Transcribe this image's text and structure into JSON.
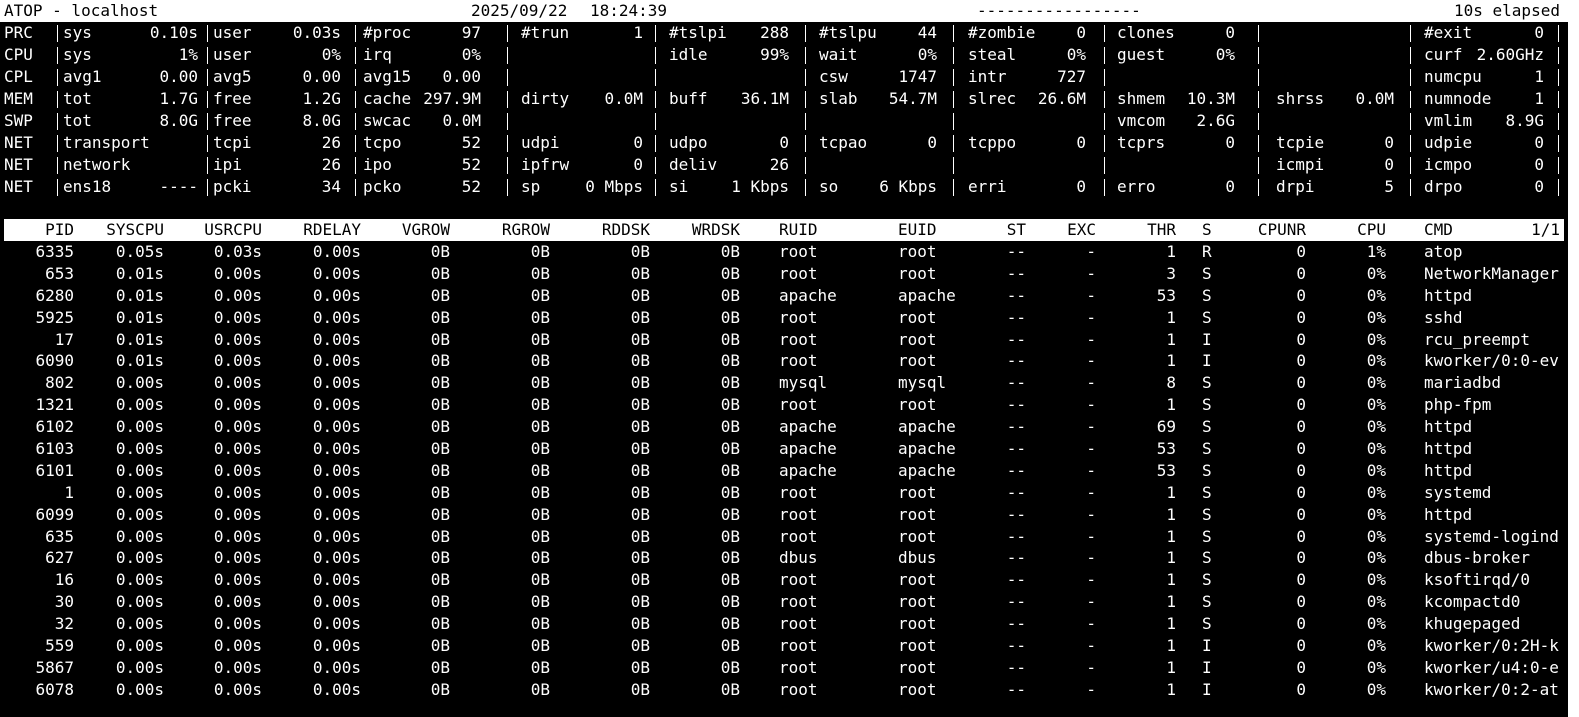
{
  "header": {
    "app": "ATOP - localhost",
    "date": "2025/09/22",
    "time": "18:24:39",
    "dashes": "-----------------",
    "elapsed": "10s elapsed"
  },
  "stats": [
    {
      "label": "PRC",
      "cells": [
        {
          "k": "sys",
          "v": "0.10s"
        },
        {
          "k": "user",
          "v": "0.03s"
        },
        {
          "k": "#proc",
          "v": "97"
        },
        {
          "k": "#trun",
          "v": "1"
        },
        {
          "k": "#tslpi",
          "v": "288"
        },
        {
          "k": "#tslpu",
          "v": "44"
        },
        {
          "k": "#zombie",
          "v": "0"
        },
        {
          "k": "clones",
          "v": "0"
        },
        {
          "k": "",
          "v": ""
        },
        {
          "k": "#exit",
          "v": "0"
        }
      ]
    },
    {
      "label": "CPU",
      "cells": [
        {
          "k": "sys",
          "v": "1%"
        },
        {
          "k": "user",
          "v": "0%"
        },
        {
          "k": "irq",
          "v": "0%"
        },
        {
          "k": "",
          "v": ""
        },
        {
          "k": "idle",
          "v": "99%"
        },
        {
          "k": "wait",
          "v": "0%"
        },
        {
          "k": "steal",
          "v": "0%"
        },
        {
          "k": "guest",
          "v": "0%"
        },
        {
          "k": "",
          "v": ""
        },
        {
          "k": "curf",
          "v": "2.60GHz"
        }
      ]
    },
    {
      "label": "CPL",
      "cells": [
        {
          "k": "avg1",
          "v": "0.00"
        },
        {
          "k": "avg5",
          "v": "0.00"
        },
        {
          "k": "avg15",
          "v": "0.00"
        },
        {
          "k": "",
          "v": ""
        },
        {
          "k": "",
          "v": ""
        },
        {
          "k": "csw",
          "v": "1747"
        },
        {
          "k": "intr",
          "v": "727"
        },
        {
          "k": "",
          "v": ""
        },
        {
          "k": "",
          "v": ""
        },
        {
          "k": "numcpu",
          "v": "1"
        }
      ]
    },
    {
      "label": "MEM",
      "cells": [
        {
          "k": "tot",
          "v": "1.7G"
        },
        {
          "k": "free",
          "v": "1.2G"
        },
        {
          "k": "cache",
          "v": "297.9M"
        },
        {
          "k": "dirty",
          "v": "0.0M"
        },
        {
          "k": "buff",
          "v": "36.1M"
        },
        {
          "k": "slab",
          "v": "54.7M"
        },
        {
          "k": "slrec",
          "v": "26.6M"
        },
        {
          "k": "shmem",
          "v": "10.3M"
        },
        {
          "k": "shrss",
          "v": "0.0M"
        },
        {
          "k": "numnode",
          "v": "1"
        }
      ]
    },
    {
      "label": "SWP",
      "cells": [
        {
          "k": "tot",
          "v": "8.0G"
        },
        {
          "k": "free",
          "v": "8.0G"
        },
        {
          "k": "swcac",
          "v": "0.0M"
        },
        {
          "k": "",
          "v": ""
        },
        {
          "k": "",
          "v": ""
        },
        {
          "k": "",
          "v": ""
        },
        {
          "k": "",
          "v": ""
        },
        {
          "k": "vmcom",
          "v": "2.6G"
        },
        {
          "k": "",
          "v": ""
        },
        {
          "k": "vmlim",
          "v": "8.9G"
        }
      ]
    },
    {
      "label": "NET",
      "cells": [
        {
          "k": "transport",
          "v": ""
        },
        {
          "k": "tcpi",
          "v": "26"
        },
        {
          "k": "tcpo",
          "v": "52"
        },
        {
          "k": "udpi",
          "v": "0"
        },
        {
          "k": "udpo",
          "v": "0"
        },
        {
          "k": "tcpao",
          "v": "0"
        },
        {
          "k": "tcppo",
          "v": "0"
        },
        {
          "k": "tcprs",
          "v": "0"
        },
        {
          "k": "tcpie",
          "v": "0"
        },
        {
          "k": "udpie",
          "v": "0"
        }
      ]
    },
    {
      "label": "NET",
      "cells": [
        {
          "k": "network",
          "v": ""
        },
        {
          "k": "ipi",
          "v": "26"
        },
        {
          "k": "ipo",
          "v": "52"
        },
        {
          "k": "ipfrw",
          "v": "0"
        },
        {
          "k": "deliv",
          "v": "26"
        },
        {
          "k": "",
          "v": ""
        },
        {
          "k": "",
          "v": ""
        },
        {
          "k": "",
          "v": ""
        },
        {
          "k": "icmpi",
          "v": "0"
        },
        {
          "k": "icmpo",
          "v": "0"
        }
      ]
    },
    {
      "label": "NET",
      "cells": [
        {
          "k": "ens18",
          "v": "----"
        },
        {
          "k": "pcki",
          "v": "34"
        },
        {
          "k": "pcko",
          "v": "52"
        },
        {
          "k": "sp",
          "v": "0 Mbps"
        },
        {
          "k": "si",
          "v": "1 Kbps"
        },
        {
          "k": "so",
          "v": "6 Kbps"
        },
        {
          "k": "erri",
          "v": "0"
        },
        {
          "k": "erro",
          "v": "0"
        },
        {
          "k": "drpi",
          "v": "5"
        },
        {
          "k": "drpo",
          "v": "0"
        }
      ]
    }
  ],
  "process_header": {
    "pid": "PID",
    "syscpu": "SYSCPU",
    "usrcpu": "USRCPU",
    "rdelay": "RDELAY",
    "vgrow": "VGROW",
    "rgrow": "RGROW",
    "rddsk": "RDDSK",
    "wrdsk": "WRDSK",
    "ruid": "RUID",
    "euid": "EUID",
    "st": "ST",
    "exc": "EXC",
    "thr": "THR",
    "s": "S",
    "cpunr": "CPUNR",
    "cpu": "CPU",
    "cmd": "CMD",
    "page": "1/1"
  },
  "processes": [
    {
      "pid": "6335",
      "syscpu": "0.05s",
      "usrcpu": "0.03s",
      "rdelay": "0.00s",
      "vgrow": "0B",
      "rgrow": "0B",
      "rddsk": "0B",
      "wrdsk": "0B",
      "ruid": "root",
      "euid": "root",
      "st": "--",
      "exc": "-",
      "thr": "1",
      "s": "R",
      "cpunr": "0",
      "cpu": "1%",
      "cmd": "atop"
    },
    {
      "pid": "653",
      "syscpu": "0.01s",
      "usrcpu": "0.00s",
      "rdelay": "0.00s",
      "vgrow": "0B",
      "rgrow": "0B",
      "rddsk": "0B",
      "wrdsk": "0B",
      "ruid": "root",
      "euid": "root",
      "st": "--",
      "exc": "-",
      "thr": "3",
      "s": "S",
      "cpunr": "0",
      "cpu": "0%",
      "cmd": "NetworkManager"
    },
    {
      "pid": "6280",
      "syscpu": "0.01s",
      "usrcpu": "0.00s",
      "rdelay": "0.00s",
      "vgrow": "0B",
      "rgrow": "0B",
      "rddsk": "0B",
      "wrdsk": "0B",
      "ruid": "apache",
      "euid": "apache",
      "st": "--",
      "exc": "-",
      "thr": "53",
      "s": "S",
      "cpunr": "0",
      "cpu": "0%",
      "cmd": "httpd"
    },
    {
      "pid": "5925",
      "syscpu": "0.01s",
      "usrcpu": "0.00s",
      "rdelay": "0.00s",
      "vgrow": "0B",
      "rgrow": "0B",
      "rddsk": "0B",
      "wrdsk": "0B",
      "ruid": "root",
      "euid": "root",
      "st": "--",
      "exc": "-",
      "thr": "1",
      "s": "S",
      "cpunr": "0",
      "cpu": "0%",
      "cmd": "sshd"
    },
    {
      "pid": "17",
      "syscpu": "0.01s",
      "usrcpu": "0.00s",
      "rdelay": "0.00s",
      "vgrow": "0B",
      "rgrow": "0B",
      "rddsk": "0B",
      "wrdsk": "0B",
      "ruid": "root",
      "euid": "root",
      "st": "--",
      "exc": "-",
      "thr": "1",
      "s": "I",
      "cpunr": "0",
      "cpu": "0%",
      "cmd": "rcu_preempt"
    },
    {
      "pid": "6090",
      "syscpu": "0.01s",
      "usrcpu": "0.00s",
      "rdelay": "0.00s",
      "vgrow": "0B",
      "rgrow": "0B",
      "rddsk": "0B",
      "wrdsk": "0B",
      "ruid": "root",
      "euid": "root",
      "st": "--",
      "exc": "-",
      "thr": "1",
      "s": "I",
      "cpunr": "0",
      "cpu": "0%",
      "cmd": "kworker/0:0-ev"
    },
    {
      "pid": "802",
      "syscpu": "0.00s",
      "usrcpu": "0.00s",
      "rdelay": "0.00s",
      "vgrow": "0B",
      "rgrow": "0B",
      "rddsk": "0B",
      "wrdsk": "0B",
      "ruid": "mysql",
      "euid": "mysql",
      "st": "--",
      "exc": "-",
      "thr": "8",
      "s": "S",
      "cpunr": "0",
      "cpu": "0%",
      "cmd": "mariadbd"
    },
    {
      "pid": "1321",
      "syscpu": "0.00s",
      "usrcpu": "0.00s",
      "rdelay": "0.00s",
      "vgrow": "0B",
      "rgrow": "0B",
      "rddsk": "0B",
      "wrdsk": "0B",
      "ruid": "root",
      "euid": "root",
      "st": "--",
      "exc": "-",
      "thr": "1",
      "s": "S",
      "cpunr": "0",
      "cpu": "0%",
      "cmd": "php-fpm"
    },
    {
      "pid": "6102",
      "syscpu": "0.00s",
      "usrcpu": "0.00s",
      "rdelay": "0.00s",
      "vgrow": "0B",
      "rgrow": "0B",
      "rddsk": "0B",
      "wrdsk": "0B",
      "ruid": "apache",
      "euid": "apache",
      "st": "--",
      "exc": "-",
      "thr": "69",
      "s": "S",
      "cpunr": "0",
      "cpu": "0%",
      "cmd": "httpd"
    },
    {
      "pid": "6103",
      "syscpu": "0.00s",
      "usrcpu": "0.00s",
      "rdelay": "0.00s",
      "vgrow": "0B",
      "rgrow": "0B",
      "rddsk": "0B",
      "wrdsk": "0B",
      "ruid": "apache",
      "euid": "apache",
      "st": "--",
      "exc": "-",
      "thr": "53",
      "s": "S",
      "cpunr": "0",
      "cpu": "0%",
      "cmd": "httpd"
    },
    {
      "pid": "6101",
      "syscpu": "0.00s",
      "usrcpu": "0.00s",
      "rdelay": "0.00s",
      "vgrow": "0B",
      "rgrow": "0B",
      "rddsk": "0B",
      "wrdsk": "0B",
      "ruid": "apache",
      "euid": "apache",
      "st": "--",
      "exc": "-",
      "thr": "53",
      "s": "S",
      "cpunr": "0",
      "cpu": "0%",
      "cmd": "httpd"
    },
    {
      "pid": "1",
      "syscpu": "0.00s",
      "usrcpu": "0.00s",
      "rdelay": "0.00s",
      "vgrow": "0B",
      "rgrow": "0B",
      "rddsk": "0B",
      "wrdsk": "0B",
      "ruid": "root",
      "euid": "root",
      "st": "--",
      "exc": "-",
      "thr": "1",
      "s": "S",
      "cpunr": "0",
      "cpu": "0%",
      "cmd": "systemd"
    },
    {
      "pid": "6099",
      "syscpu": "0.00s",
      "usrcpu": "0.00s",
      "rdelay": "0.00s",
      "vgrow": "0B",
      "rgrow": "0B",
      "rddsk": "0B",
      "wrdsk": "0B",
      "ruid": "root",
      "euid": "root",
      "st": "--",
      "exc": "-",
      "thr": "1",
      "s": "S",
      "cpunr": "0",
      "cpu": "0%",
      "cmd": "httpd"
    },
    {
      "pid": "635",
      "syscpu": "0.00s",
      "usrcpu": "0.00s",
      "rdelay": "0.00s",
      "vgrow": "0B",
      "rgrow": "0B",
      "rddsk": "0B",
      "wrdsk": "0B",
      "ruid": "root",
      "euid": "root",
      "st": "--",
      "exc": "-",
      "thr": "1",
      "s": "S",
      "cpunr": "0",
      "cpu": "0%",
      "cmd": "systemd-logind"
    },
    {
      "pid": "627",
      "syscpu": "0.00s",
      "usrcpu": "0.00s",
      "rdelay": "0.00s",
      "vgrow": "0B",
      "rgrow": "0B",
      "rddsk": "0B",
      "wrdsk": "0B",
      "ruid": "dbus",
      "euid": "dbus",
      "st": "--",
      "exc": "-",
      "thr": "1",
      "s": "S",
      "cpunr": "0",
      "cpu": "0%",
      "cmd": "dbus-broker"
    },
    {
      "pid": "16",
      "syscpu": "0.00s",
      "usrcpu": "0.00s",
      "rdelay": "0.00s",
      "vgrow": "0B",
      "rgrow": "0B",
      "rddsk": "0B",
      "wrdsk": "0B",
      "ruid": "root",
      "euid": "root",
      "st": "--",
      "exc": "-",
      "thr": "1",
      "s": "S",
      "cpunr": "0",
      "cpu": "0%",
      "cmd": "ksoftirqd/0"
    },
    {
      "pid": "30",
      "syscpu": "0.00s",
      "usrcpu": "0.00s",
      "rdelay": "0.00s",
      "vgrow": "0B",
      "rgrow": "0B",
      "rddsk": "0B",
      "wrdsk": "0B",
      "ruid": "root",
      "euid": "root",
      "st": "--",
      "exc": "-",
      "thr": "1",
      "s": "S",
      "cpunr": "0",
      "cpu": "0%",
      "cmd": "kcompactd0"
    },
    {
      "pid": "32",
      "syscpu": "0.00s",
      "usrcpu": "0.00s",
      "rdelay": "0.00s",
      "vgrow": "0B",
      "rgrow": "0B",
      "rddsk": "0B",
      "wrdsk": "0B",
      "ruid": "root",
      "euid": "root",
      "st": "--",
      "exc": "-",
      "thr": "1",
      "s": "S",
      "cpunr": "0",
      "cpu": "0%",
      "cmd": "khugepaged"
    },
    {
      "pid": "559",
      "syscpu": "0.00s",
      "usrcpu": "0.00s",
      "rdelay": "0.00s",
      "vgrow": "0B",
      "rgrow": "0B",
      "rddsk": "0B",
      "wrdsk": "0B",
      "ruid": "root",
      "euid": "root",
      "st": "--",
      "exc": "-",
      "thr": "1",
      "s": "I",
      "cpunr": "0",
      "cpu": "0%",
      "cmd": "kworker/0:2H-k"
    },
    {
      "pid": "5867",
      "syscpu": "0.00s",
      "usrcpu": "0.00s",
      "rdelay": "0.00s",
      "vgrow": "0B",
      "rgrow": "0B",
      "rddsk": "0B",
      "wrdsk": "0B",
      "ruid": "root",
      "euid": "root",
      "st": "--",
      "exc": "-",
      "thr": "1",
      "s": "I",
      "cpunr": "0",
      "cpu": "0%",
      "cmd": "kworker/u4:0-e"
    },
    {
      "pid": "6078",
      "syscpu": "0.00s",
      "usrcpu": "0.00s",
      "rdelay": "0.00s",
      "vgrow": "0B",
      "rgrow": "0B",
      "rddsk": "0B",
      "wrdsk": "0B",
      "ruid": "root",
      "euid": "root",
      "st": "--",
      "exc": "-",
      "thr": "1",
      "s": "I",
      "cpunr": "0",
      "cpu": "0%",
      "cmd": "kworker/0:2-at"
    }
  ],
  "colors": {
    "background": "#000000",
    "foreground": "#ffffff",
    "header_bg": "#ffffff",
    "header_fg": "#000000"
  }
}
